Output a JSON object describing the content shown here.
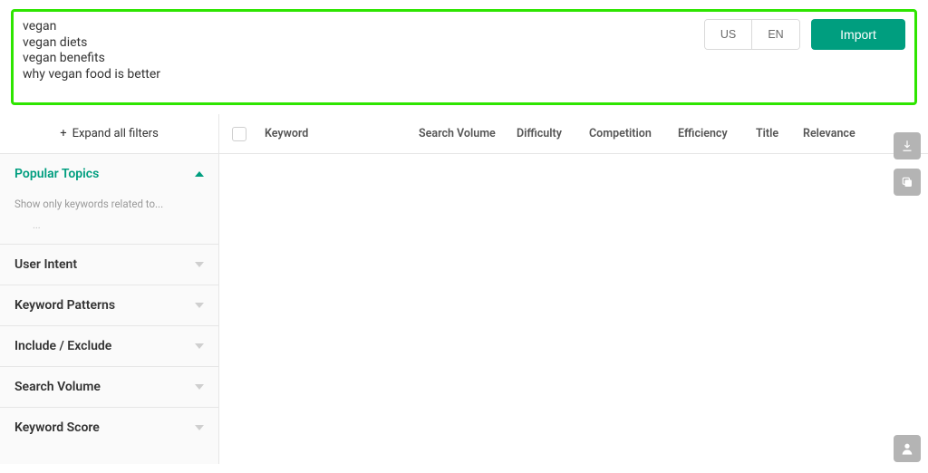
{
  "import": {
    "textarea_value": "vegan\nvegan diets\nvegan benefits\nwhy vegan food is better",
    "country_label": "US",
    "language_label": "EN",
    "import_button": "Import"
  },
  "sidebar": {
    "expand_all_label": "Expand all filters",
    "popular_topics": {
      "title": "Popular Topics",
      "hint": "Show only keywords related to...",
      "ellipsis": "..."
    },
    "filters": [
      {
        "title": "User Intent"
      },
      {
        "title": "Keyword Patterns"
      },
      {
        "title": "Include / Exclude"
      },
      {
        "title": "Search Volume"
      },
      {
        "title": "Keyword Score"
      }
    ]
  },
  "table": {
    "headers": {
      "keyword": "Keyword",
      "search_volume": "Search Volume",
      "difficulty": "Difficulty",
      "competition": "Competition",
      "efficiency": "Efficiency",
      "title": "Title",
      "relevance": "Relevance"
    }
  },
  "icons": {
    "download": "download-icon",
    "copy": "copy-icon",
    "profile": "profile-icon"
  }
}
